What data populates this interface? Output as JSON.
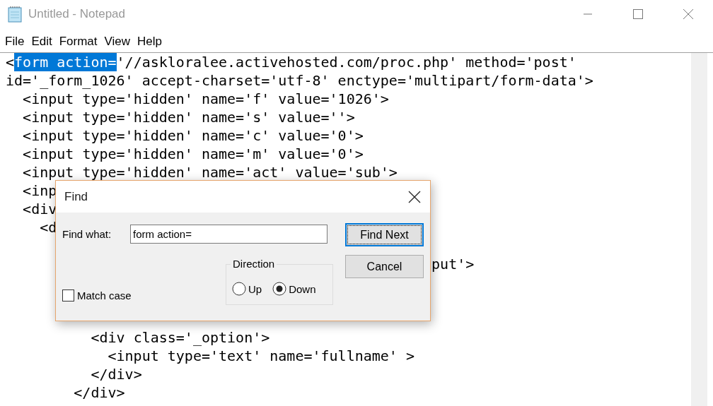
{
  "window": {
    "title": "Untitled - Notepad",
    "active": false
  },
  "menu": [
    "File",
    "Edit",
    "Format",
    "View",
    "Help"
  ],
  "editor": {
    "lines": [
      {
        "kind": "text",
        "parts": [
          {
            "text": "<",
            "selected": false
          },
          {
            "text": "form action=",
            "selected": true
          },
          {
            "text": "'//askloralee.activehosted.com/proc.php' method='post'",
            "selected": false
          }
        ]
      },
      {
        "kind": "text",
        "parts": [
          {
            "text": "id='_form_1026' accept-charset='utf-8' enctype='multipart/form-data'>",
            "selected": false
          }
        ]
      },
      {
        "kind": "text",
        "parts": [
          {
            "text": "  <input type='hidden' name='f' value='1026'>",
            "selected": false
          }
        ]
      },
      {
        "kind": "text",
        "parts": [
          {
            "text": "  <input type='hidden' name='s' value=''>",
            "selected": false
          }
        ]
      },
      {
        "kind": "text",
        "parts": [
          {
            "text": "  <input type='hidden' name='c' value='0'>",
            "selected": false
          }
        ]
      },
      {
        "kind": "text",
        "parts": [
          {
            "text": "  <input type='hidden' name='m' value='0'>",
            "selected": false
          }
        ]
      },
      {
        "kind": "text",
        "parts": [
          {
            "text": "  <input type='hidden' name='act' value='sub'>",
            "selected": false
          }
        ]
      },
      {
        "kind": "text",
        "parts": [
          {
            "text": "  <inp",
            "selected": false
          }
        ]
      },
      {
        "kind": "text",
        "parts": [
          {
            "text": "  <div",
            "selected": false
          }
        ]
      },
      {
        "kind": "text",
        "parts": [
          {
            "text": "    <d",
            "selected": false
          }
        ]
      },
      {
        "kind": "blank"
      },
      {
        "kind": "text",
        "parts": [
          {
            "text": "                                                  put'>",
            "selected": false
          }
        ]
      },
      {
        "kind": "blank"
      },
      {
        "kind": "blank"
      },
      {
        "kind": "blank"
      },
      {
        "kind": "text",
        "parts": [
          {
            "text": "          <div class='_option'>",
            "selected": false
          }
        ]
      },
      {
        "kind": "text",
        "parts": [
          {
            "text": "            <input type='text' name='fullname' >",
            "selected": false
          }
        ]
      },
      {
        "kind": "text",
        "parts": [
          {
            "text": "          </div>",
            "selected": false
          }
        ]
      },
      {
        "kind": "text",
        "parts": [
          {
            "text": "        </div>",
            "selected": false
          }
        ]
      }
    ]
  },
  "find_dialog": {
    "title": "Find",
    "find_what": {
      "label": "Find what:",
      "value": "form action="
    },
    "buttons": [
      {
        "label": "Find Next",
        "default": true
      },
      {
        "label": "Cancel",
        "default": false
      }
    ],
    "direction": {
      "label": "Direction",
      "options": [
        {
          "label": "Up",
          "selected": false
        },
        {
          "label": "Down",
          "selected": true
        }
      ]
    },
    "match_case": {
      "label": "Match case",
      "checked": false
    }
  }
}
